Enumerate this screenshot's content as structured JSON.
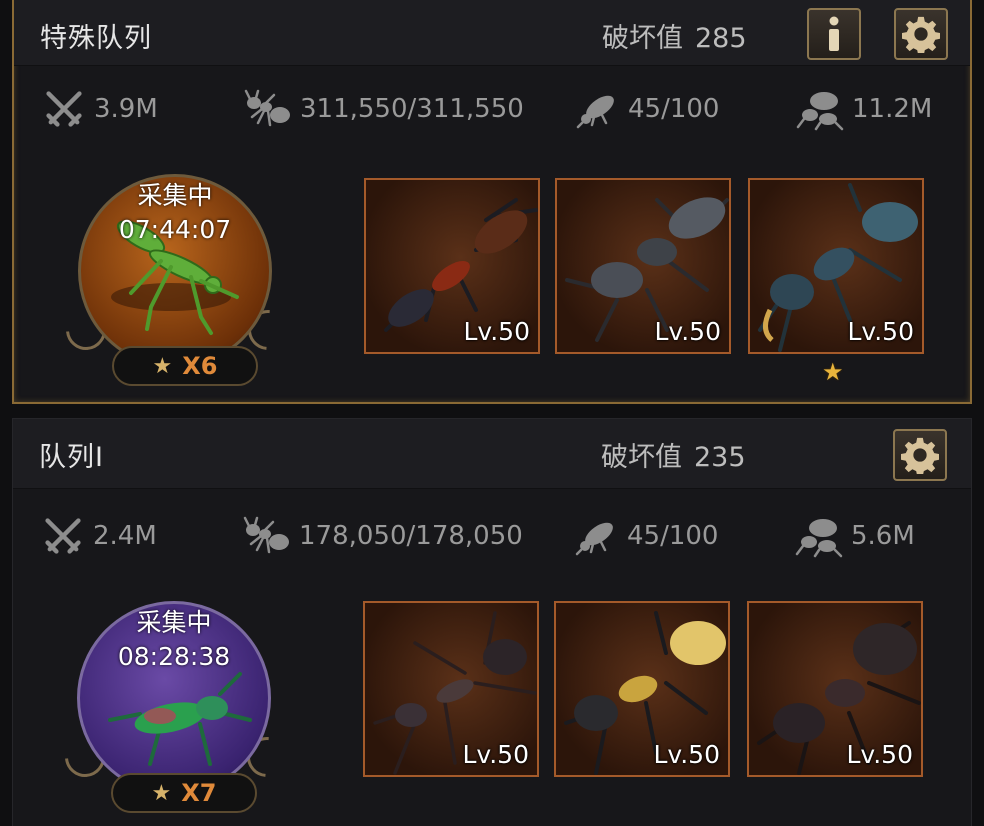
{
  "squads": [
    {
      "title": "特殊队列",
      "damage_label": "破坏值",
      "damage_value": "285",
      "stats": [
        "3.9M",
        "311,550/311,550",
        "45/100",
        "11.2M"
      ],
      "status": "采集中",
      "timer": "07:44:07",
      "star_count": "X6",
      "cards": [
        {
          "level": "Lv.50"
        },
        {
          "level": "Lv.50"
        },
        {
          "level": "Lv.50"
        }
      ],
      "card_star": "★"
    },
    {
      "title": "队列I",
      "damage_label": "破坏值",
      "damage_value": "235",
      "stats": [
        "2.4M",
        "178,050/178,050",
        "45/100",
        "5.6M"
      ],
      "status": "采集中",
      "timer": "08:28:38",
      "star_count": "X7",
      "cards": [
        {
          "level": "Lv.50"
        },
        {
          "level": "Lv.50"
        },
        {
          "level": "Lv.50"
        }
      ]
    }
  ],
  "icons": {
    "info_button": "info-icon",
    "settings_button": "gear-icon",
    "stat_icons": [
      "crossed-swords-icon",
      "ant-icon",
      "beetle-icon",
      "carry-ant-icon"
    ]
  },
  "colors": {
    "accent_gold": "#8c7750",
    "star_orange": "#e08a3a",
    "card_border": "#a45a2a"
  }
}
